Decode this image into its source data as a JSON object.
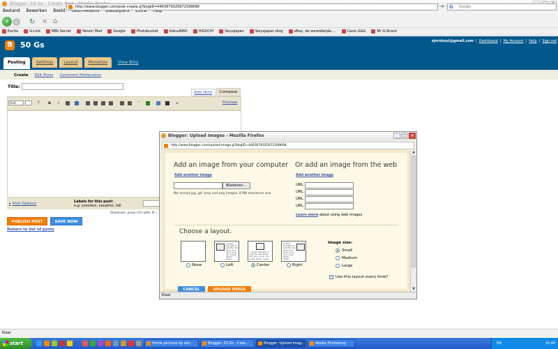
{
  "browser": {
    "title": "Blogger: 50 Gs - Create Post - Mozilla Firefox",
    "menu": [
      "Bestand",
      "Bewerken",
      "Beeld",
      "Geschiedenis",
      "Bladwijzers",
      "Extra",
      "Help"
    ],
    "url": "http://www.blogger.com/post-create.g?blogID=4463679325672599668",
    "search_placeholder": "Google",
    "bookmarks": [
      "Excite",
      "G-Link",
      "BBS Secret",
      "Yahoo! Mail",
      "Google",
      "Photobucket",
      "KatsuNAVI",
      "HIGUCHI",
      "SeiyaJapan",
      "SeiyaJapan blog",
      "eBay, de wereldwijde ...",
      "Casio G&G",
      "Mr G-Shock"
    ],
    "status": "Klaar"
  },
  "blogger": {
    "logo": "B",
    "blog_title": "50 Gs",
    "user_email": "sjorskuyt@gmail.com",
    "links": [
      "Dashboard",
      "My Account",
      "Help",
      "Sign out"
    ],
    "tabs": [
      "Posting",
      "Settings",
      "Layout",
      "Monetize",
      "View Blog"
    ],
    "subtabs": [
      "Create",
      "Edit Posts",
      "Comment Moderation"
    ]
  },
  "editor": {
    "title_label": "Title:",
    "edit_html": "Edit Html",
    "compose": "Compose",
    "font": "Font",
    "preview": "Preview",
    "post_options": "Post Options",
    "labels_title": "Labels for this post:",
    "labels_eg": "e.g. scooters, vacation, fall",
    "shortcuts": "Shortcuts: press Ctrl with: B = B",
    "publish": "PUBLISH POST",
    "save": "SAVE NOW",
    "return": "Return to list of posts"
  },
  "popup": {
    "title": "Blogger: Upload Images - Mozilla Firefox",
    "url": "http://www.blogger.com/upload-image.g?blogID=4463679325672599668",
    "add_computer": "Add an image from your computer",
    "add_web": "Or add an image from the web",
    "add_another": "Add another image",
    "browse": "Bladeren...",
    "accept": "We accept jpg, gif, bmp and png images. 8 MB maximum size",
    "url_label": "URL",
    "learn_more": "Learn more",
    "learn_more_suffix": "about using web images",
    "layout_heading": "Choose a layout.",
    "layouts": [
      "None",
      "Left",
      "Center",
      "Right"
    ],
    "layout_selected": "Center",
    "sample_text": "I never thought I'd see the day when the hour is up. You know what I mean",
    "image_size_heading": "Image size:",
    "sizes": [
      "Small",
      "Medium",
      "Large"
    ],
    "size_selected": "Small",
    "use_layout": "Use this layout every time?",
    "cancel": "CANCEL",
    "upload": "UPLOAD IMAGE",
    "status": "Klaar"
  },
  "taskbar": {
    "start": "start",
    "tasks": [
      "Home pictures by sizr...",
      "Blogger: 50 Gs - Crea...",
      "Blogger: Upload Imag...",
      "Adobe Photoshop"
    ],
    "active_task": "Blogger: Upload Imag...",
    "lang": "EN",
    "time": "16:48"
  }
}
